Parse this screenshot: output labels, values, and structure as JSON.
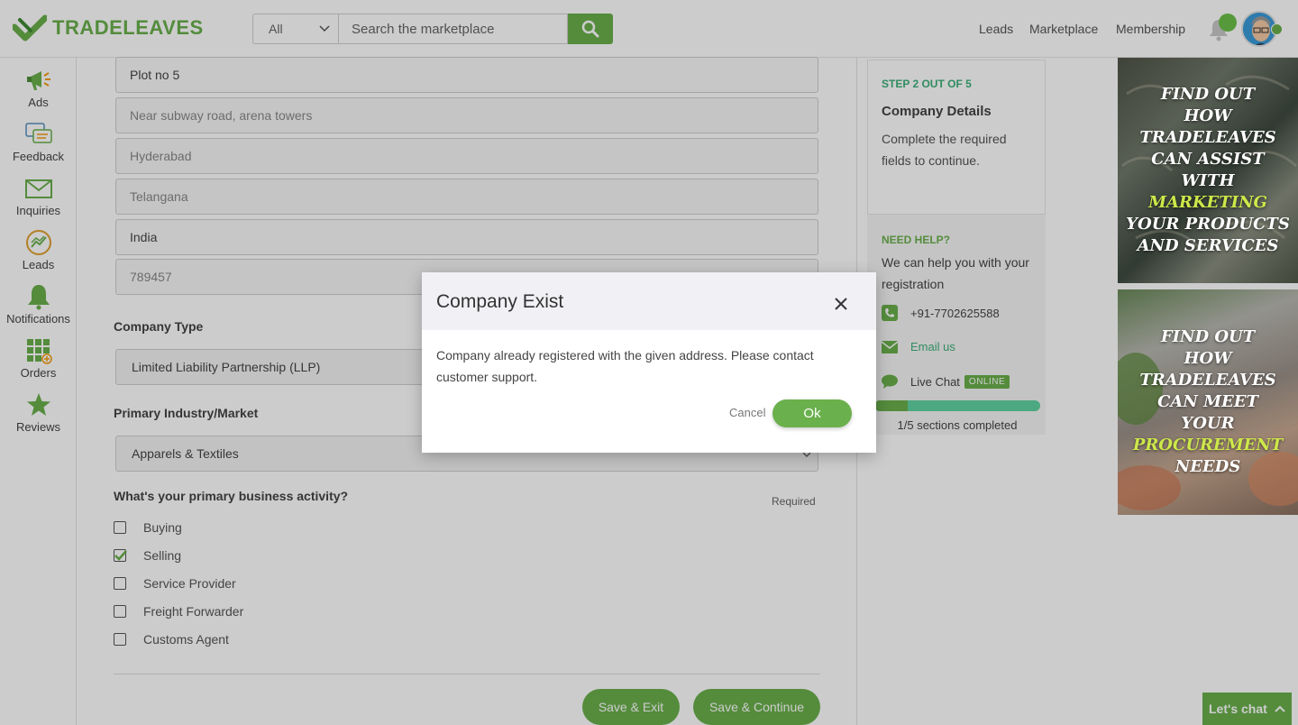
{
  "brand": {
    "logo_text": "TRADELEAVES",
    "accent": "#6ab04c",
    "teal": "#3cb07a"
  },
  "search": {
    "category": "All",
    "placeholder": "Search the marketplace"
  },
  "nav": {
    "leads": "Leads",
    "marketplace": "Marketplace",
    "membership": "Membership"
  },
  "sidebar": {
    "items": [
      {
        "label": "Ads",
        "icon": "megaphone-icon"
      },
      {
        "label": "Feedback",
        "icon": "feedback-icon"
      },
      {
        "label": "Inquiries",
        "icon": "envelope-icon"
      },
      {
        "label": "Leads",
        "icon": "leads-chart-icon"
      },
      {
        "label": "Notifications",
        "icon": "bell-icon"
      },
      {
        "label": "Orders",
        "icon": "orders-grid-icon"
      },
      {
        "label": "Reviews",
        "icon": "star-icon"
      }
    ]
  },
  "form": {
    "address_line1": "Plot no 5",
    "address_line2": "Near subway road, arena towers",
    "city": "Hyderabad",
    "state": "Telangana",
    "country": "India",
    "zip": "789457",
    "company_type_label": "Company Type",
    "company_type_value": "Limited Liability Partnership (LLP)",
    "industry_label": "Primary Industry/Market",
    "industry_value": "Apparels & Textiles",
    "activity_label": "What's your primary business activity?",
    "required_label": "Required",
    "activities": [
      {
        "label": "Buying",
        "checked": false
      },
      {
        "label": "Selling",
        "checked": true
      },
      {
        "label": "Service Provider",
        "checked": false
      },
      {
        "label": "Freight Forwarder",
        "checked": false
      },
      {
        "label": "Customs Agent",
        "checked": false
      }
    ],
    "save_exit": "Save & Exit",
    "save_continue": "Save & Continue"
  },
  "step": {
    "label": "STEP 2 OUT OF 5",
    "title": "Company Details",
    "description": "Complete the required fields to continue."
  },
  "help": {
    "label": "NEED HELP?",
    "description": "We can help you with your registration",
    "phone": "+91-7702625588",
    "email": "Email us",
    "chat": "Live Chat",
    "online": "ONLINE",
    "progress_text": "1/5 sections completed",
    "progress_fraction": 0.2
  },
  "ads": {
    "ad1": {
      "line1": "FIND OUT",
      "line2": "HOW",
      "line3": "TRADELEAVES",
      "line4": "CAN ASSIST",
      "line5": "WITH",
      "highlight": "MARKETING",
      "line6": "YOUR PRODUCTS",
      "line7": "AND SERVICES"
    },
    "ad2": {
      "line1": "FIND OUT",
      "line2": "HOW",
      "line3": "TRADELEAVES",
      "line4": "CAN MEET",
      "line5": "YOUR",
      "highlight": "PROCUREMENT",
      "line6": "NEEDS"
    }
  },
  "chat_widget": {
    "label": "Let's chat"
  },
  "modal": {
    "title": "Company Exist",
    "message": "Company already registered with the given address. Please contact customer support.",
    "cancel": "Cancel",
    "ok": "Ok"
  }
}
